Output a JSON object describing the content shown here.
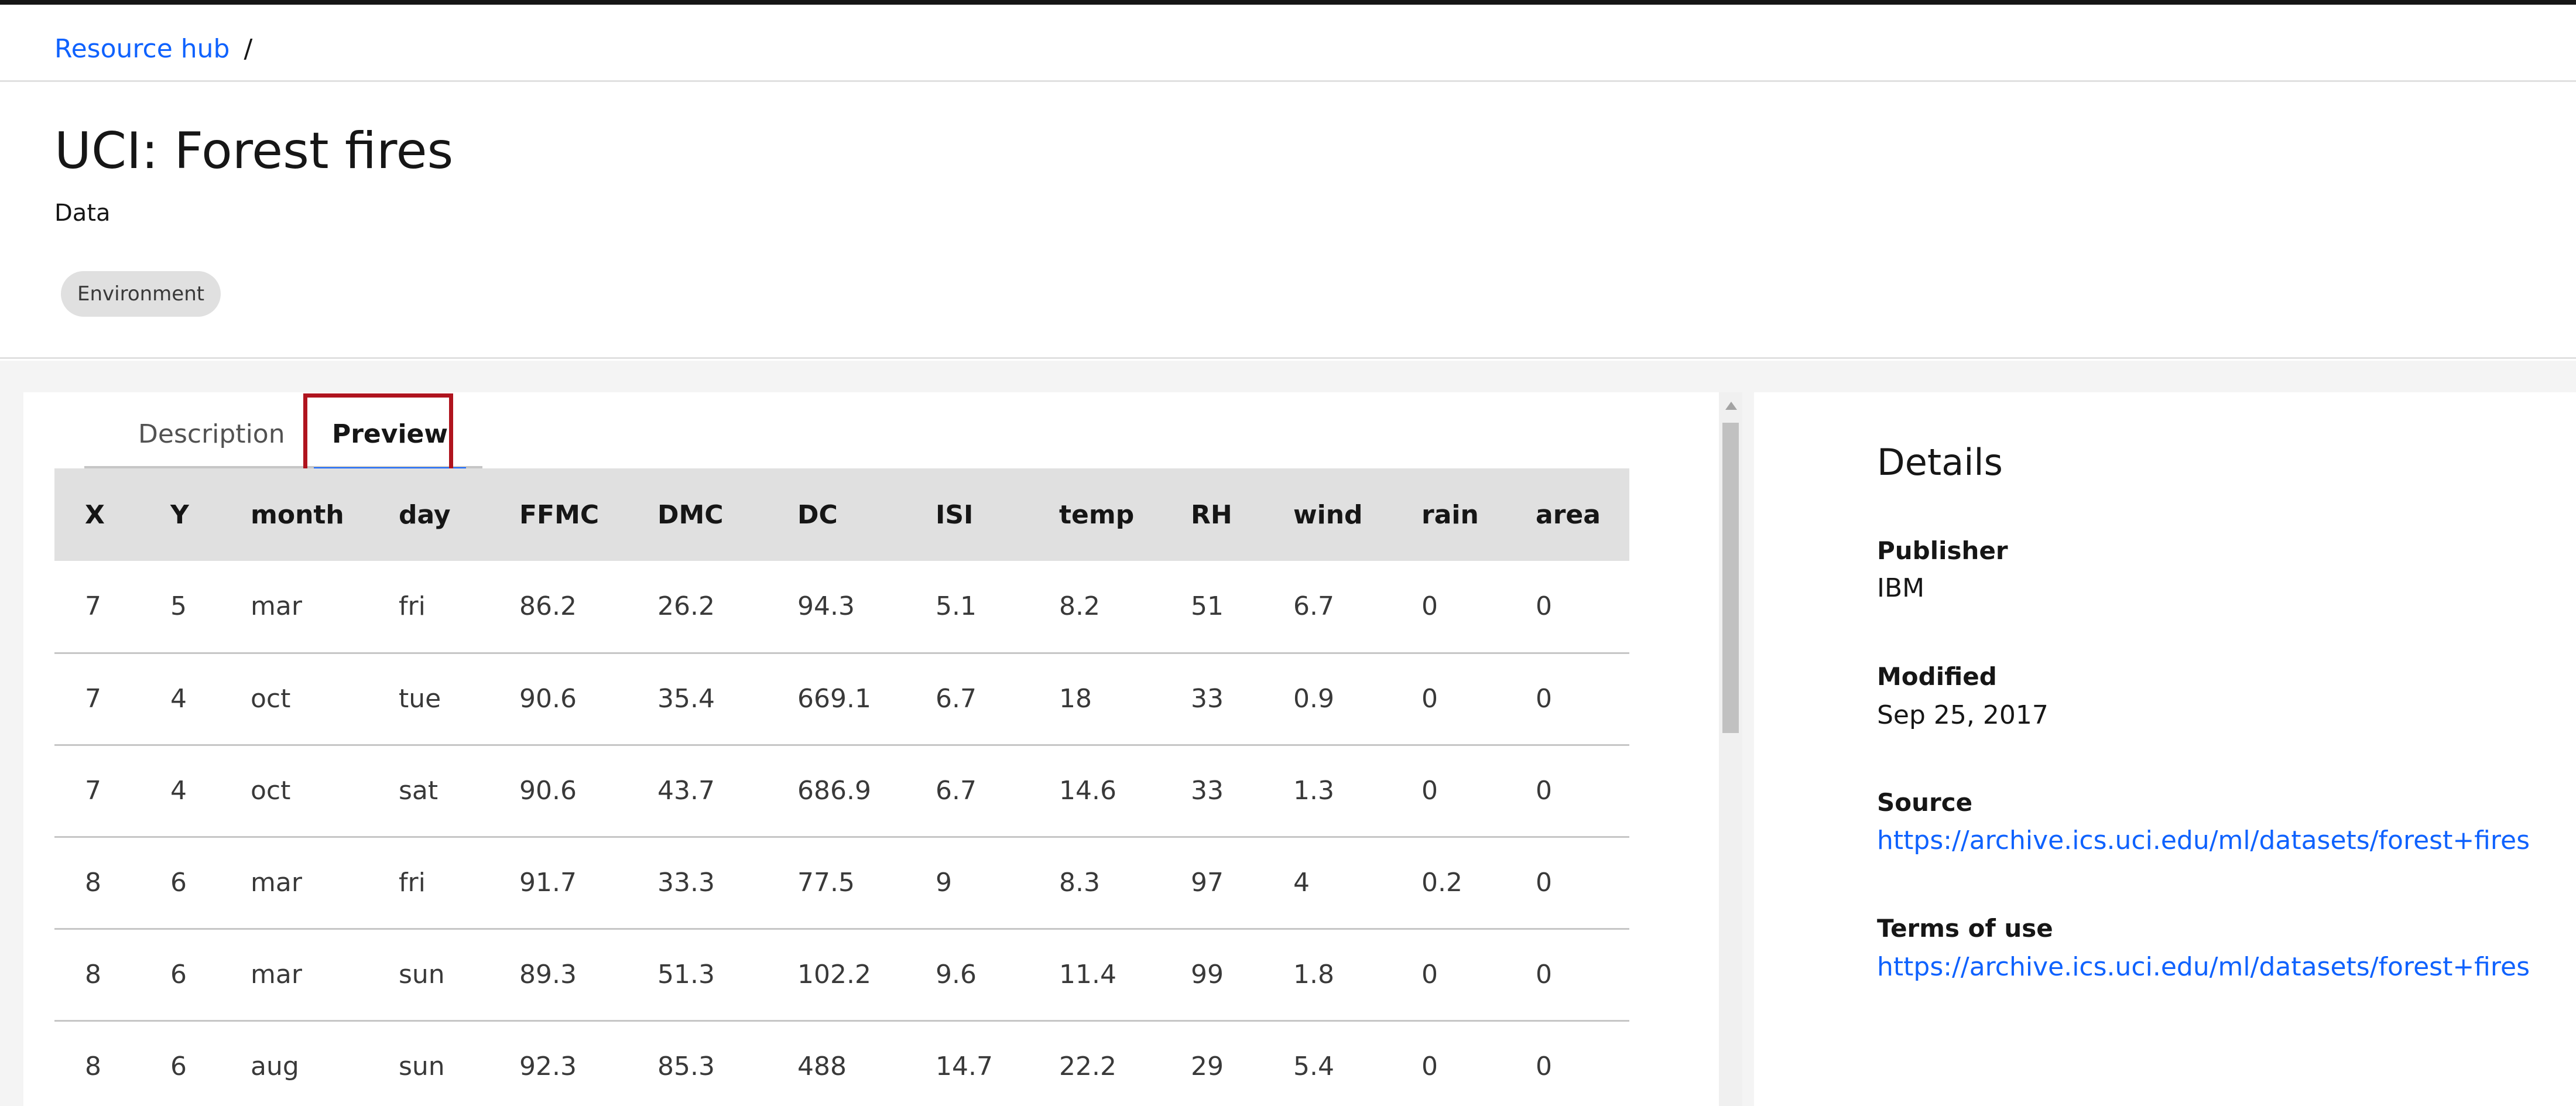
{
  "breadcrumb": {
    "root": "Resource hub",
    "separator": "/"
  },
  "header": {
    "title": "UCI: Forest fires",
    "type": "Data",
    "tag": "Environment"
  },
  "tabs": [
    {
      "label": "Description"
    },
    {
      "label": "Preview"
    }
  ],
  "table": {
    "columns": [
      "X",
      "Y",
      "month",
      "day",
      "FFMC",
      "DMC",
      "DC",
      "ISI",
      "temp",
      "RH",
      "wind",
      "rain",
      "area"
    ],
    "rows": [
      [
        "7",
        "5",
        "mar",
        "fri",
        "86.2",
        "26.2",
        "94.3",
        "5.1",
        "8.2",
        "51",
        "6.7",
        "0",
        "0"
      ],
      [
        "7",
        "4",
        "oct",
        "tue",
        "90.6",
        "35.4",
        "669.1",
        "6.7",
        "18",
        "33",
        "0.9",
        "0",
        "0"
      ],
      [
        "7",
        "4",
        "oct",
        "sat",
        "90.6",
        "43.7",
        "686.9",
        "6.7",
        "14.6",
        "33",
        "1.3",
        "0",
        "0"
      ],
      [
        "8",
        "6",
        "mar",
        "fri",
        "91.7",
        "33.3",
        "77.5",
        "9",
        "8.3",
        "97",
        "4",
        "0.2",
        "0"
      ],
      [
        "8",
        "6",
        "mar",
        "sun",
        "89.3",
        "51.3",
        "102.2",
        "9.6",
        "11.4",
        "99",
        "1.8",
        "0",
        "0"
      ],
      [
        "8",
        "6",
        "aug",
        "sun",
        "92.3",
        "85.3",
        "488",
        "14.7",
        "22.2",
        "29",
        "5.4",
        "0",
        "0"
      ]
    ]
  },
  "details": {
    "title": "Details",
    "publisher_label": "Publisher",
    "publisher": "IBM",
    "modified_label": "Modified",
    "modified": "Sep 25, 2017",
    "source_label": "Source",
    "source": "https://archive.ics.uci.edu/ml/datasets/forest+fires",
    "terms_label": "Terms of use",
    "terms": "https://archive.ics.uci.edu/ml/datasets/forest+fires"
  },
  "colors": {
    "link": "#0f62fe",
    "highlight": "#b0141e",
    "tab_indicator": "#0f62fe"
  }
}
